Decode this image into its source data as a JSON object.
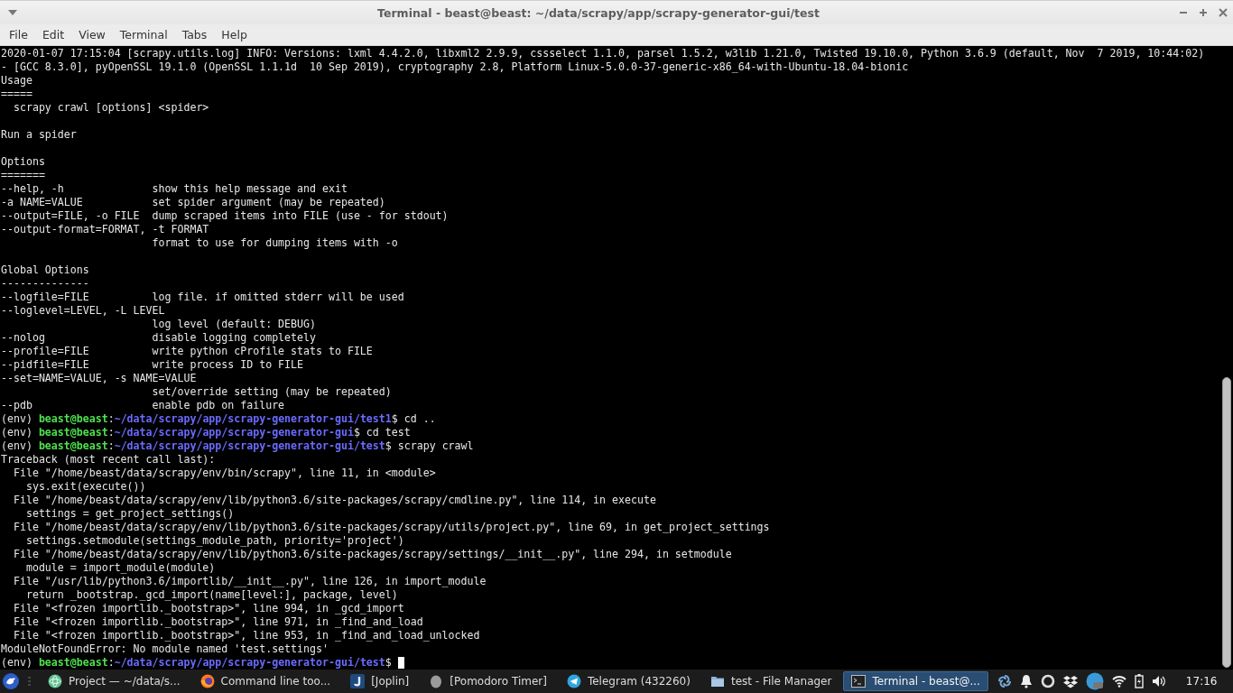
{
  "window": {
    "title": "Terminal - beast@beast: ~/data/scrapy/app/scrapy-generator-gui/test"
  },
  "menu": [
    "File",
    "Edit",
    "View",
    "Terminal",
    "Tabs",
    "Help"
  ],
  "terminal": {
    "lines": [
      {
        "kind": "text",
        "text": "2020-01-07 17:15:04 [scrapy.utils.log] INFO: Versions: lxml 4.4.2.0, libxml2 2.9.9, cssselect 1.1.0, parsel 1.5.2, w3lib 1.21.0, Twisted 19.10.0, Python 3.6.9 (default, Nov  7 2019, 10:44:02)"
      },
      {
        "kind": "text",
        "text": "- [GCC 8.3.0], pyOpenSSL 19.1.0 (OpenSSL 1.1.1d  10 Sep 2019), cryptography 2.8, Platform Linux-5.0.0-37-generic-x86_64-with-Ubuntu-18.04-bionic"
      },
      {
        "kind": "text",
        "text": "Usage"
      },
      {
        "kind": "text",
        "text": "====="
      },
      {
        "kind": "text",
        "text": "  scrapy crawl [options] <spider>"
      },
      {
        "kind": "blank"
      },
      {
        "kind": "text",
        "text": "Run a spider"
      },
      {
        "kind": "blank"
      },
      {
        "kind": "text",
        "text": "Options"
      },
      {
        "kind": "text",
        "text": "======="
      },
      {
        "kind": "text",
        "text": "--help, -h              show this help message and exit"
      },
      {
        "kind": "text",
        "text": "-a NAME=VALUE           set spider argument (may be repeated)"
      },
      {
        "kind": "text",
        "text": "--output=FILE, -o FILE  dump scraped items into FILE (use - for stdout)"
      },
      {
        "kind": "text",
        "text": "--output-format=FORMAT, -t FORMAT"
      },
      {
        "kind": "text",
        "text": "                        format to use for dumping items with -o"
      },
      {
        "kind": "blank"
      },
      {
        "kind": "text",
        "text": "Global Options"
      },
      {
        "kind": "text",
        "text": "--------------"
      },
      {
        "kind": "text",
        "text": "--logfile=FILE          log file. if omitted stderr will be used"
      },
      {
        "kind": "text",
        "text": "--loglevel=LEVEL, -L LEVEL"
      },
      {
        "kind": "text",
        "text": "                        log level (default: DEBUG)"
      },
      {
        "kind": "text",
        "text": "--nolog                 disable logging completely"
      },
      {
        "kind": "text",
        "text": "--profile=FILE          write python cProfile stats to FILE"
      },
      {
        "kind": "text",
        "text": "--pidfile=FILE          write process ID to FILE"
      },
      {
        "kind": "text",
        "text": "--set=NAME=VALUE, -s NAME=VALUE"
      },
      {
        "kind": "text",
        "text": "                        set/override setting (may be repeated)"
      },
      {
        "kind": "text",
        "text": "--pdb                   enable pdb on failure"
      },
      {
        "kind": "prompt",
        "env": "(env) ",
        "user": "beast@beast",
        "sep": ":",
        "path": "~/data/scrapy/app/scrapy-generator-gui/test1",
        "command": "$ cd .."
      },
      {
        "kind": "prompt",
        "env": "(env) ",
        "user": "beast@beast",
        "sep": ":",
        "path": "~/data/scrapy/app/scrapy-generator-gui",
        "command": "$ cd test"
      },
      {
        "kind": "prompt",
        "env": "(env) ",
        "user": "beast@beast",
        "sep": ":",
        "path": "~/data/scrapy/app/scrapy-generator-gui/test",
        "command": "$ scrapy crawl"
      },
      {
        "kind": "text",
        "text": "Traceback (most recent call last):"
      },
      {
        "kind": "text",
        "text": "  File \"/home/beast/data/scrapy/env/bin/scrapy\", line 11, in <module>"
      },
      {
        "kind": "text",
        "text": "    sys.exit(execute())"
      },
      {
        "kind": "text",
        "text": "  File \"/home/beast/data/scrapy/env/lib/python3.6/site-packages/scrapy/cmdline.py\", line 114, in execute"
      },
      {
        "kind": "text",
        "text": "    settings = get_project_settings()"
      },
      {
        "kind": "text",
        "text": "  File \"/home/beast/data/scrapy/env/lib/python3.6/site-packages/scrapy/utils/project.py\", line 69, in get_project_settings"
      },
      {
        "kind": "text",
        "text": "    settings.setmodule(settings_module_path, priority='project')"
      },
      {
        "kind": "text",
        "text": "  File \"/home/beast/data/scrapy/env/lib/python3.6/site-packages/scrapy/settings/__init__.py\", line 294, in setmodule"
      },
      {
        "kind": "text",
        "text": "    module = import_module(module)"
      },
      {
        "kind": "text",
        "text": "  File \"/usr/lib/python3.6/importlib/__init__.py\", line 126, in import_module"
      },
      {
        "kind": "text",
        "text": "    return _bootstrap._gcd_import(name[level:], package, level)"
      },
      {
        "kind": "text",
        "text": "  File \"<frozen importlib._bootstrap>\", line 994, in _gcd_import"
      },
      {
        "kind": "text",
        "text": "  File \"<frozen importlib._bootstrap>\", line 971, in _find_and_load"
      },
      {
        "kind": "text",
        "text": "  File \"<frozen importlib._bootstrap>\", line 953, in _find_and_load_unlocked"
      },
      {
        "kind": "text",
        "text": "ModuleNotFoundError: No module named 'test.settings'"
      },
      {
        "kind": "prompt",
        "env": "(env) ",
        "user": "beast@beast",
        "sep": ":",
        "path": "~/data/scrapy/app/scrapy-generator-gui/test",
        "command": "$"
      }
    ],
    "cursor": true
  },
  "taskbar": {
    "tasks": [
      {
        "kind": "atom",
        "label": "Project — ~/data/s...",
        "selected": false
      },
      {
        "kind": "firefox",
        "label": "Command line too...",
        "selected": false
      },
      {
        "kind": "joplin",
        "label": "[Joplin]",
        "selected": false
      },
      {
        "kind": "egg",
        "label": "[Pomodoro Timer]",
        "selected": false
      },
      {
        "kind": "telegram",
        "label": "Telegram (432260)",
        "selected": false
      },
      {
        "kind": "folder",
        "label": "test - File Manager",
        "selected": false
      },
      {
        "kind": "terminal",
        "label": "Terminal - beast@...",
        "selected": true
      }
    ],
    "clock": "17:16"
  }
}
